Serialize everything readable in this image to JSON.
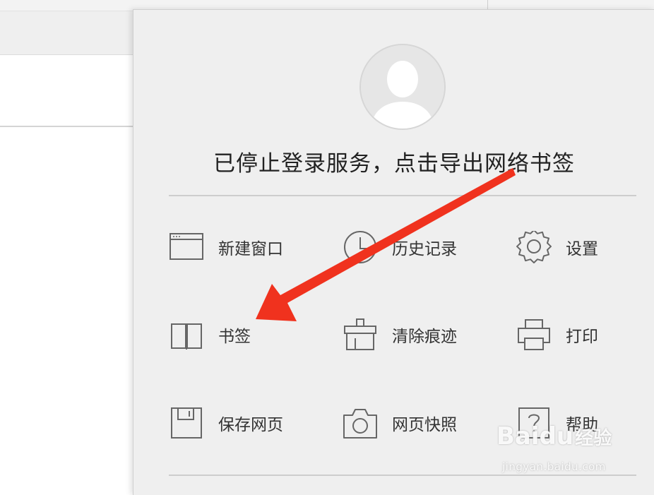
{
  "menu_panel": {
    "message": "已停止登录服务，点击导出网络书签",
    "items": [
      {
        "label": "新建窗口",
        "icon": "new-window-icon"
      },
      {
        "label": "历史记录",
        "icon": "history-clock-icon"
      },
      {
        "label": "设置",
        "icon": "settings-gear-icon"
      },
      {
        "label": "书签",
        "icon": "bookmark-book-icon"
      },
      {
        "label": "清除痕迹",
        "icon": "clear-traces-icon"
      },
      {
        "label": "打印",
        "icon": "printer-icon"
      },
      {
        "label": "保存网页",
        "icon": "save-page-icon"
      },
      {
        "label": "网页快照",
        "icon": "camera-icon"
      },
      {
        "label": "帮助",
        "icon": "help-icon"
      }
    ]
  },
  "annotation": {
    "arrow_color": "#f0321e"
  },
  "watermark": {
    "brand": "Baidu",
    "product": "经验",
    "url": "jingyan.baidu.com"
  },
  "colors": {
    "panel_bg": "#efefef",
    "icon_stroke": "#666666",
    "text": "#222222"
  }
}
